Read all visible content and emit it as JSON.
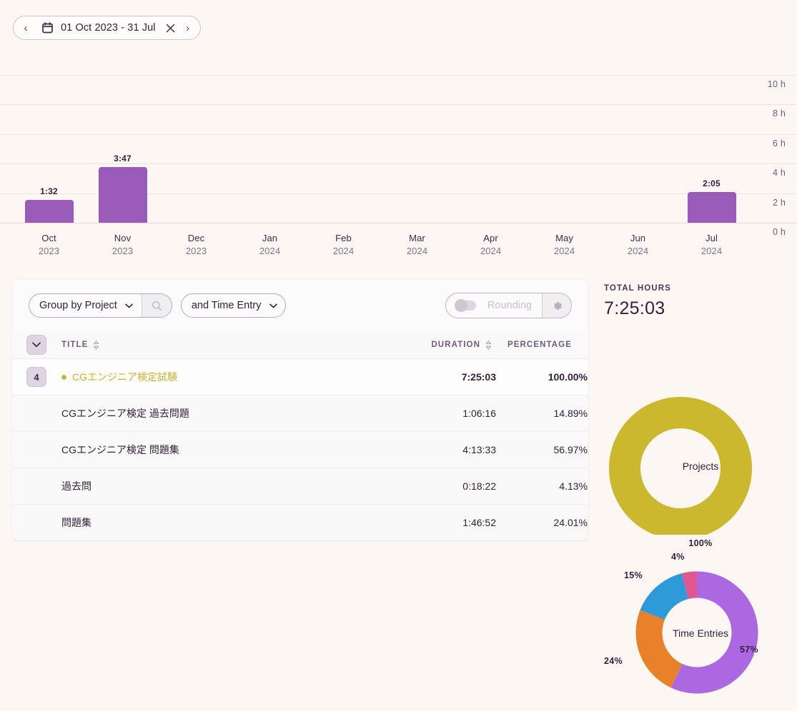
{
  "daterange": {
    "prev_label": "‹",
    "next_label": "›",
    "calendar_icon": "calendar-icon",
    "label": "01 Oct 2023 - 31 Jul",
    "clear_label": "×"
  },
  "chart_data": {
    "type": "bar",
    "title": "",
    "xlabel": "",
    "ylabel": "",
    "grid": true,
    "ylim": [
      0,
      10
    ],
    "y_ticks": [
      "0 h",
      "2 h",
      "4 h",
      "6 h",
      "8 h",
      "10 h"
    ],
    "y_tick_values": [
      0,
      2,
      4,
      6,
      8,
      10
    ],
    "categories": [
      "Oct",
      "Nov",
      "Dec",
      "Jan",
      "Feb",
      "Mar",
      "Apr",
      "May",
      "Jun",
      "Jul"
    ],
    "category_years": [
      "2023",
      "2023",
      "2023",
      "2024",
      "2024",
      "2024",
      "2024",
      "2024",
      "2024",
      "2024"
    ],
    "values": [
      1.533,
      3.783,
      0,
      0,
      0,
      0,
      0,
      0,
      0,
      2.083
    ],
    "value_labels": [
      "1:32",
      "3:47",
      "",
      "",
      "",
      "",
      "",
      "",
      "",
      "2:05"
    ],
    "bar_color": "#9a5cb8"
  },
  "toolbar": {
    "group_by_label": "Group by Project",
    "search_icon": "search-icon",
    "second_group_label": "and Time Entry",
    "rounding_label": "Rounding",
    "rounding_enabled": false,
    "gear_icon": "gear-icon"
  },
  "table": {
    "expand_toggle": "⌄",
    "columns": {
      "title": "TITLE",
      "duration": "DURATION",
      "percentage": "PERCENTAGE"
    },
    "project_row": {
      "count": "4",
      "title": "CGエンジニア検定試験",
      "duration": "7:25:03",
      "percentage": "100.00%",
      "dot_color": "#ccb82e"
    },
    "rows": [
      {
        "title": "CGエンジニア検定 過去問題",
        "duration": "1:06:16",
        "percentage": "14.89%"
      },
      {
        "title": "CGエンジニア検定 問題集",
        "duration": "4:13:33",
        "percentage": "56.97%"
      },
      {
        "title": "過去問",
        "duration": "0:18:22",
        "percentage": "4.13%"
      },
      {
        "title": "問題集",
        "duration": "1:46:52",
        "percentage": "24.01%"
      }
    ]
  },
  "summary": {
    "total_hours_label": "TOTAL HOURS",
    "total_hours_value": "7:25:03",
    "projects_donut": {
      "center_label": "Projects",
      "slices": [
        {
          "label": "100%",
          "value": 100,
          "color": "#ccb82e"
        }
      ],
      "bottom_label": "100%"
    },
    "time_entries_donut": {
      "center_label": "Time Entries",
      "slices": [
        {
          "label": "57%",
          "value": 57,
          "color": "#ab68e0"
        },
        {
          "label": "24%",
          "value": 24,
          "color": "#e8812a"
        },
        {
          "label": "15%",
          "value": 15,
          "color": "#2f9ad8"
        },
        {
          "label": "4%",
          "value": 4,
          "color": "#e0568f"
        }
      ]
    }
  }
}
